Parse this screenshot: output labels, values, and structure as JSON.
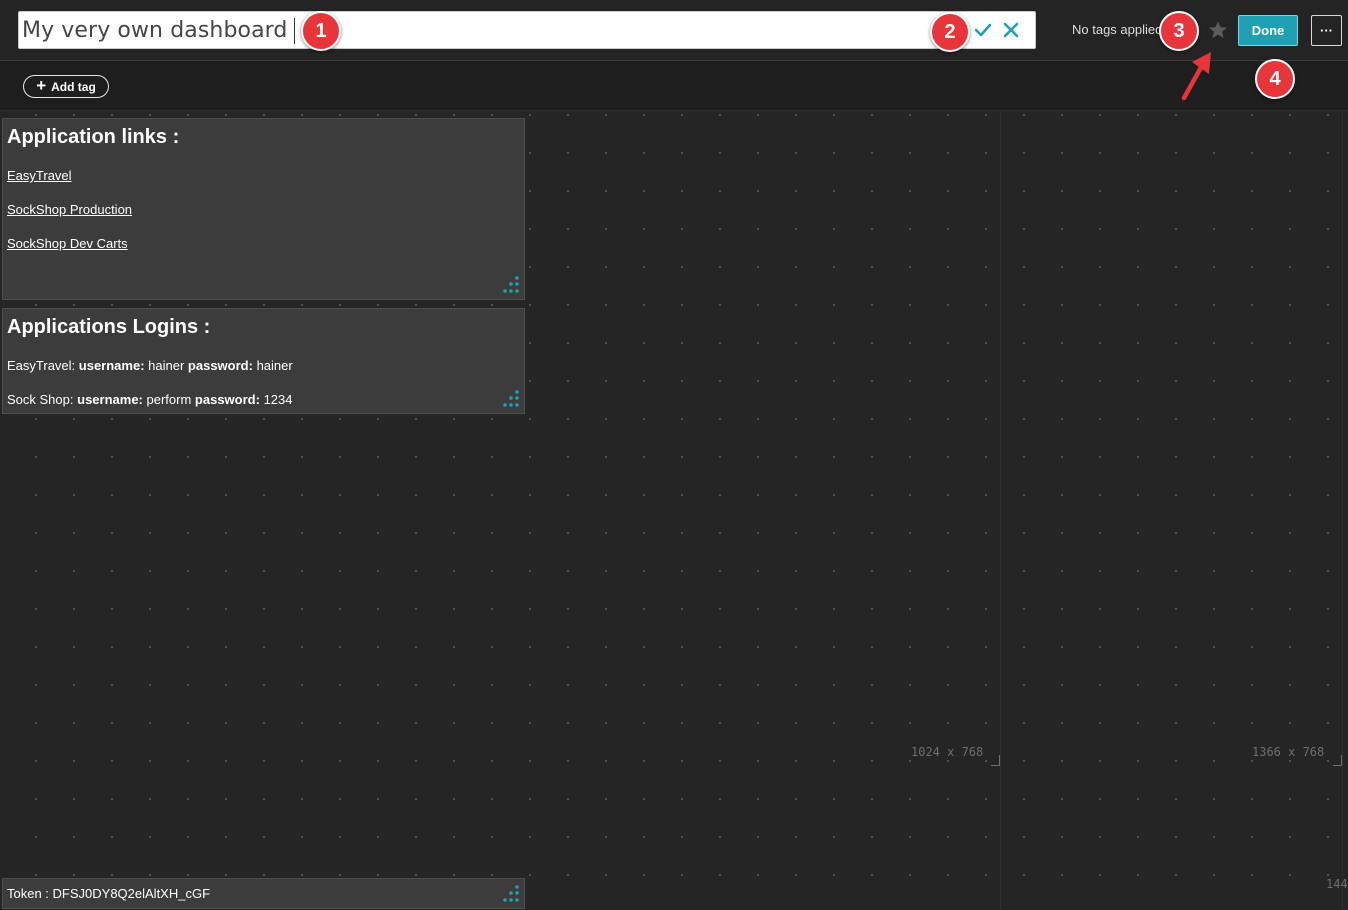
{
  "header": {
    "title_value": "My very own dashboard",
    "tags_status": "No tags applied",
    "done_label": "Done",
    "more_label": "···",
    "add_tag_label": "Add tag",
    "icons": [
      "check-icon",
      "close-icon",
      "star-icon",
      "plus-icon"
    ]
  },
  "tiles": {
    "links": {
      "title": "Application links :",
      "items": [
        "EasyTravel",
        "SockShop Production",
        "SockShop Dev Carts"
      ]
    },
    "logins": {
      "title": "Applications Logins :",
      "rows": [
        {
          "app": "EasyTravel:",
          "user_label": "username:",
          "user": "hainer",
          "pass_label": "password:",
          "pass": "hainer"
        },
        {
          "app": "Sock Shop:",
          "user_label": "username:",
          "user": "perform",
          "pass_label": "password:",
          "pass": "1234"
        }
      ]
    },
    "token": {
      "text": "Token : DFSJ0DY8Q2elAltXH_cGF"
    }
  },
  "canvas": {
    "resolution_markers": [
      "1024 x 768",
      "1366 x 768",
      "144"
    ]
  },
  "callouts": [
    "1",
    "2",
    "3",
    "4"
  ],
  "colors": {
    "accent": "#1fa0b4",
    "callout": "#e8353a",
    "background": "#252525",
    "tile": "#3c3c3c"
  }
}
